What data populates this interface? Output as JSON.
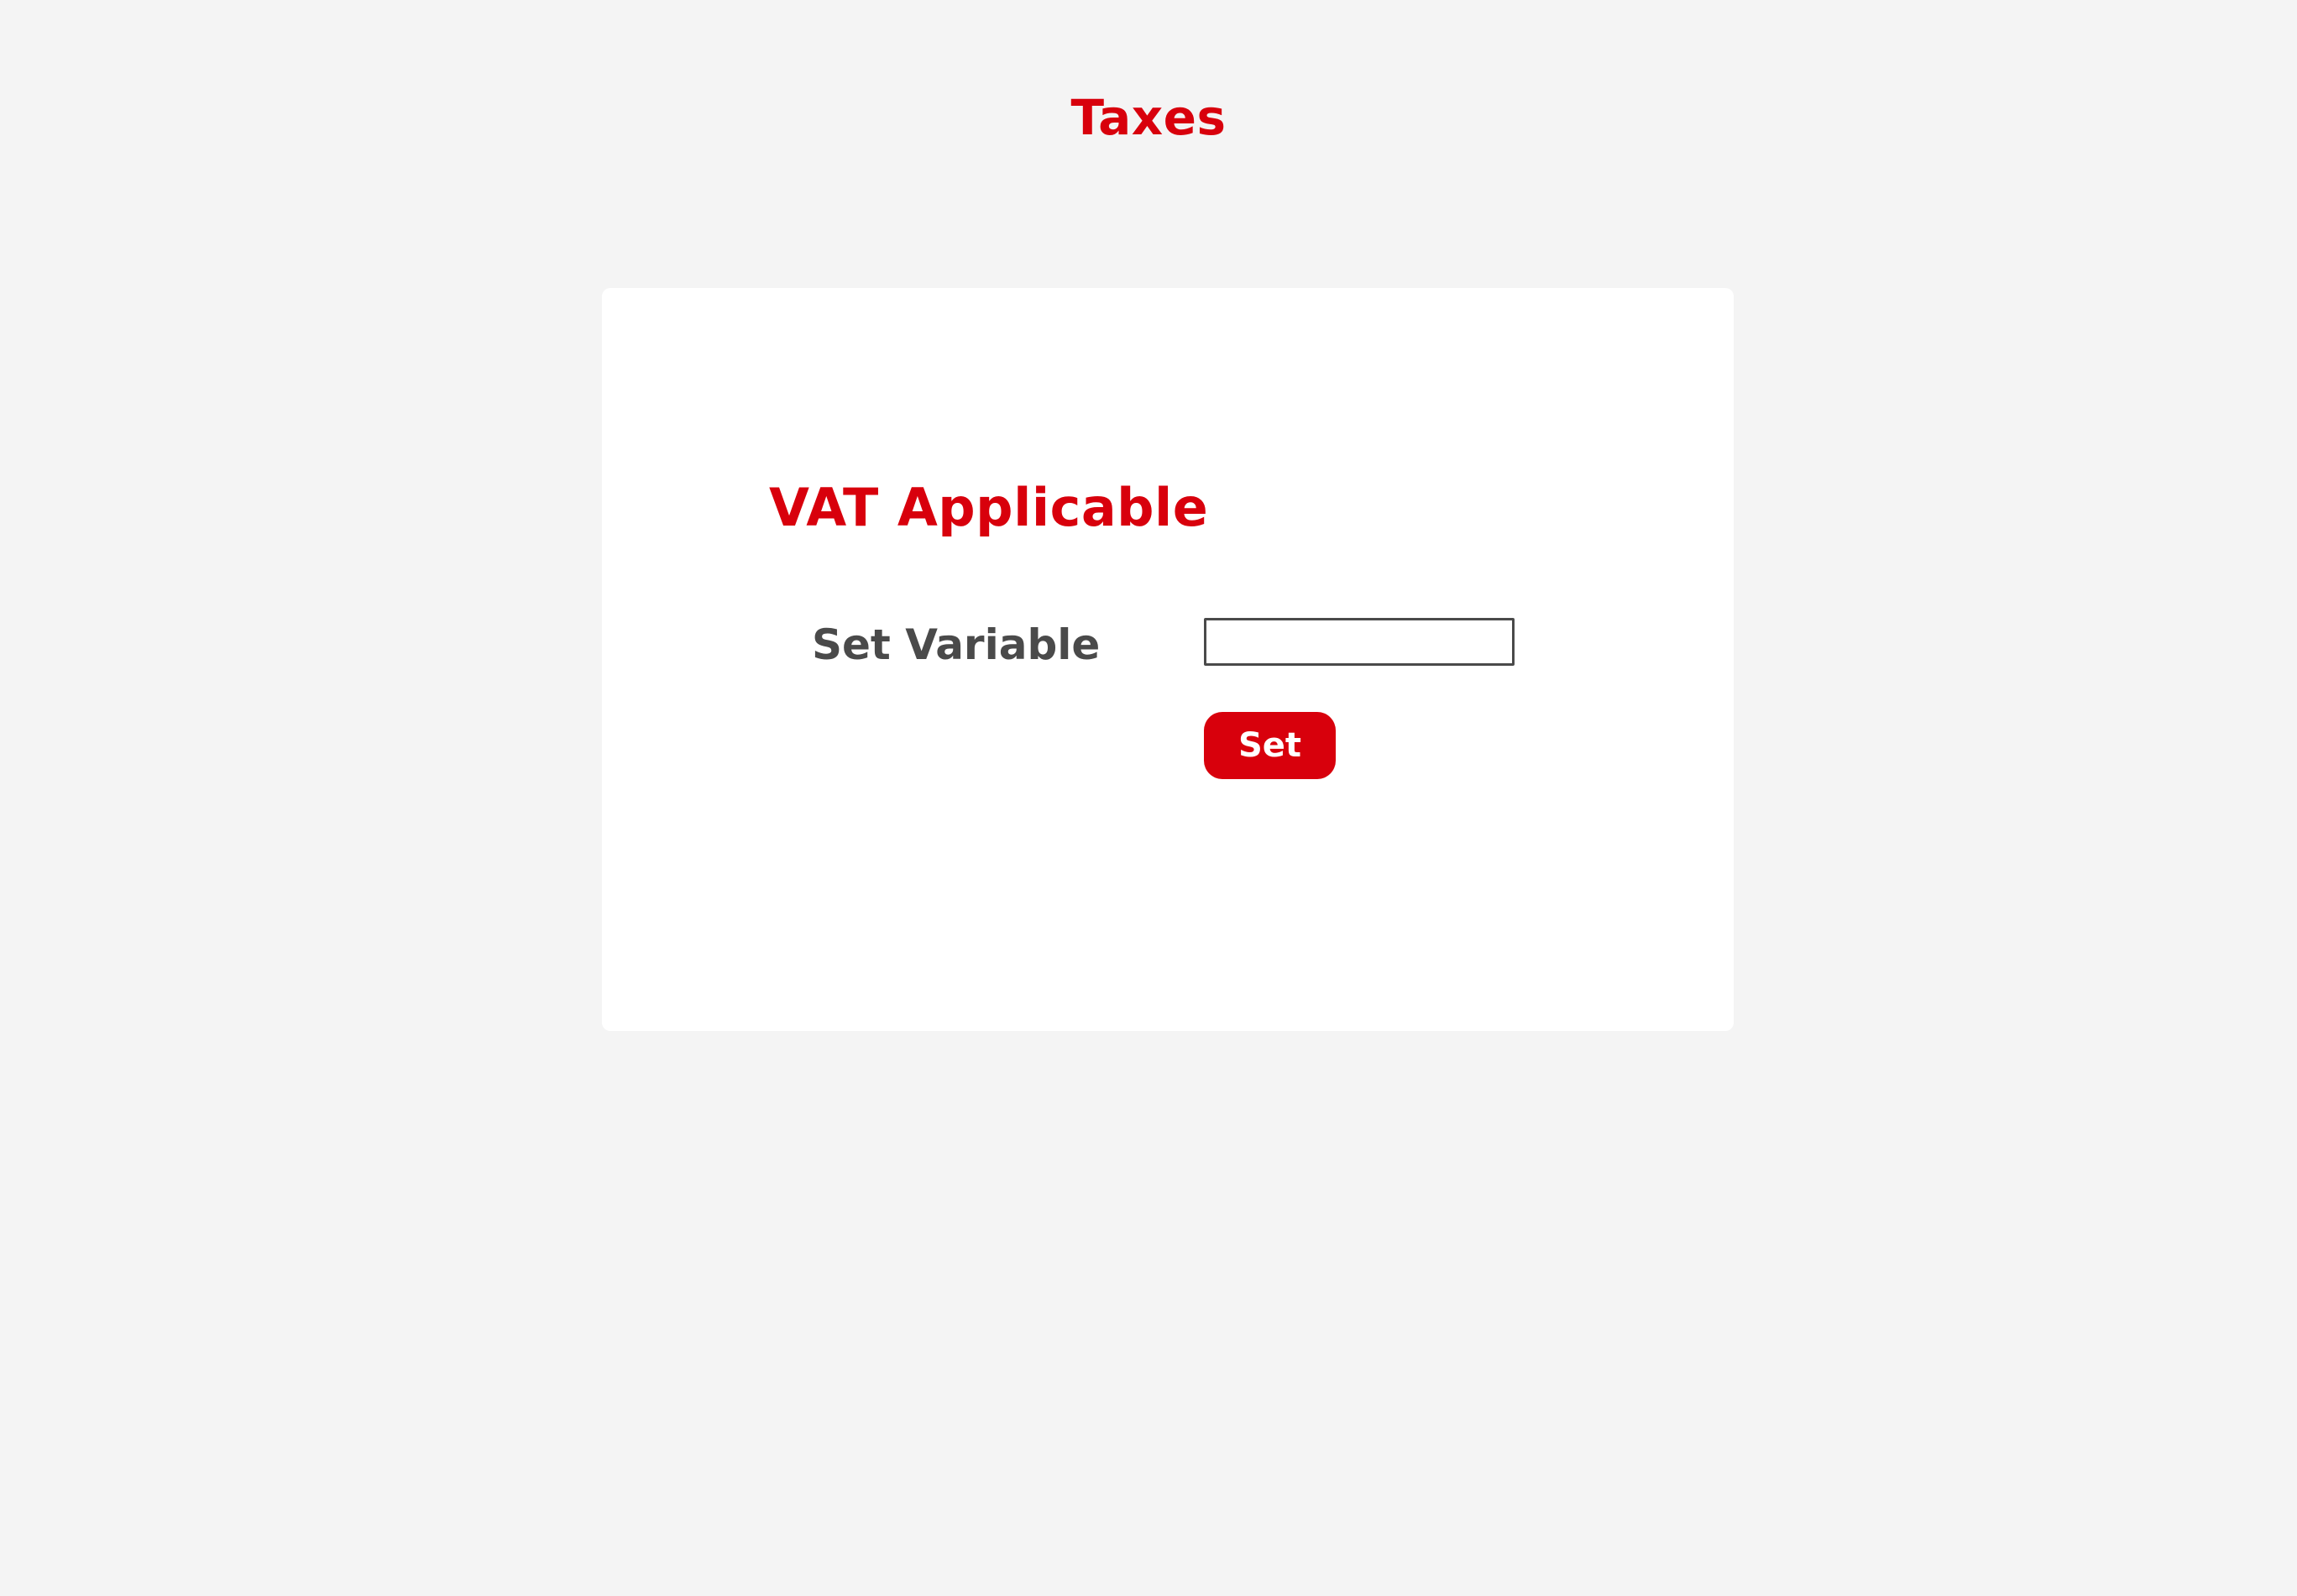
{
  "page": {
    "title": "Taxes"
  },
  "card": {
    "section_title": "VAT Applicable",
    "variable_field": {
      "label": "Set Variable",
      "value": "",
      "placeholder": ""
    },
    "set_button_label": "Set"
  },
  "colors": {
    "accent": "#d8000c",
    "background": "#f4f4f4",
    "card": "#ffffff",
    "label_text": "#4a4a4a"
  }
}
